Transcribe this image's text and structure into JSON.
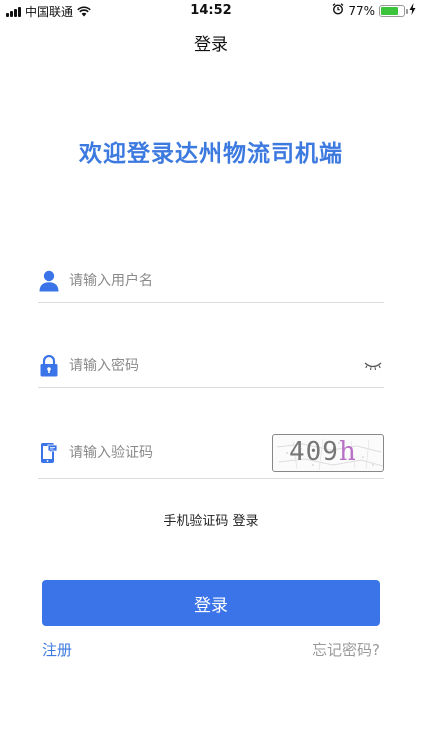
{
  "status_bar": {
    "carrier": "中国联通",
    "time": "14:52",
    "battery_percent": "77%",
    "battery_level": 0.77,
    "icons": [
      "signal-icon",
      "wifi-icon",
      "alarm-icon",
      "battery-icon",
      "charging-icon"
    ]
  },
  "nav": {
    "title": "登录"
  },
  "welcome": "欢迎登录达州物流司机端",
  "form": {
    "username": {
      "value": "",
      "placeholder": "请输入用户名",
      "icon": "user-icon"
    },
    "password": {
      "value": "",
      "placeholder": "请输入密码",
      "icon": "lock-icon",
      "toggle_icon": "eye-closed-icon"
    },
    "code": {
      "value": "",
      "placeholder": "请输入验证码",
      "icon": "phone-message-icon",
      "captcha_text": "409",
      "captcha_last": "h"
    }
  },
  "sms_login": "手机验证码 登录",
  "login_button": "登录",
  "register": "注册",
  "forgot_password": "忘记密码?",
  "colors": {
    "accent": "#3a74e8",
    "title": "#3d7ae0",
    "muted": "#9a9a9a"
  }
}
